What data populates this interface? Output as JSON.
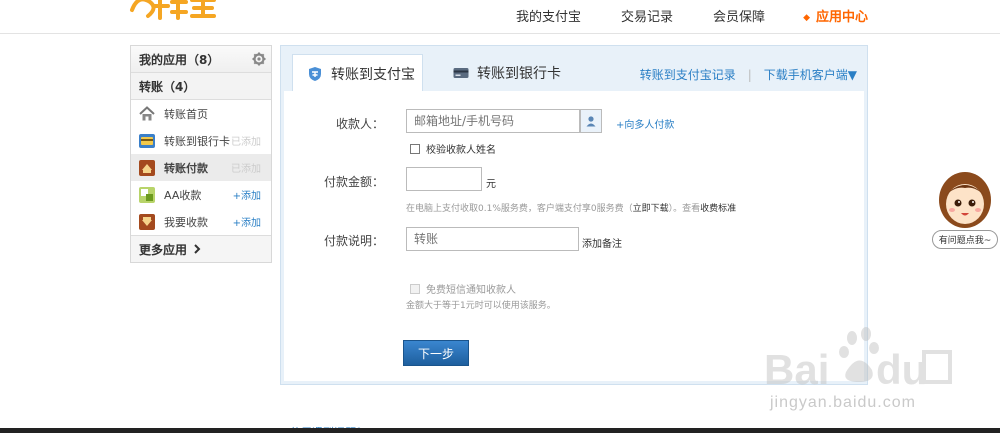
{
  "header": {
    "nav": [
      "我的支付宝",
      "交易记录",
      "会员保障",
      "应用中心"
    ],
    "active_nav": "应用中心",
    "accent_color": "#ff6600"
  },
  "sidebar": {
    "my_apps": "我的应用（8）",
    "group": "转账（4）",
    "items": [
      {
        "label": "转账首页",
        "icon": "home-icon",
        "tag": ""
      },
      {
        "label": "转账到银行卡",
        "icon": "bank-card-icon",
        "tag": "已添加"
      },
      {
        "label": "转账付款",
        "icon": "transfer-icon",
        "tag": "已添加"
      },
      {
        "label": "AA收款",
        "icon": "aa-icon",
        "tag": "+添加"
      },
      {
        "label": "我要收款",
        "icon": "receive-icon",
        "tag": "+添加"
      }
    ],
    "more": "更多应用"
  },
  "tabs": {
    "active": "转账到支付宝",
    "inactive": "转账到银行卡",
    "record_link": "转账到支付宝记录",
    "download_link": "下载手机客户端▼"
  },
  "form": {
    "payee_label": "收款人：",
    "payee_placeholder": "邮箱地址/手机号码",
    "multi_pay_link": "+向多人付款",
    "verify_name": "校验收款人姓名",
    "amount_label": "付款金额：",
    "amount_unit": "元",
    "fee_note": "在电脑上支付收取0.1%服务费，客户端支付享0服务费（",
    "fee_download": "立即下载",
    "fee_note_end": "）。查看",
    "fee_standard": "收费标准",
    "remark_label": "付款说明：",
    "remark_placeholder": "转账",
    "add_remark": "添加备注",
    "sms_notify": "免费短信通知收款人",
    "sms_condition": "金额大于等于1元时可以使用该服务。",
    "submit": "下一步"
  },
  "help": {
    "text": "有问题点我~"
  },
  "watermark": {
    "text": "jingyan.baidu.com"
  },
  "footer": {
    "text": "使用遇到问题？"
  }
}
